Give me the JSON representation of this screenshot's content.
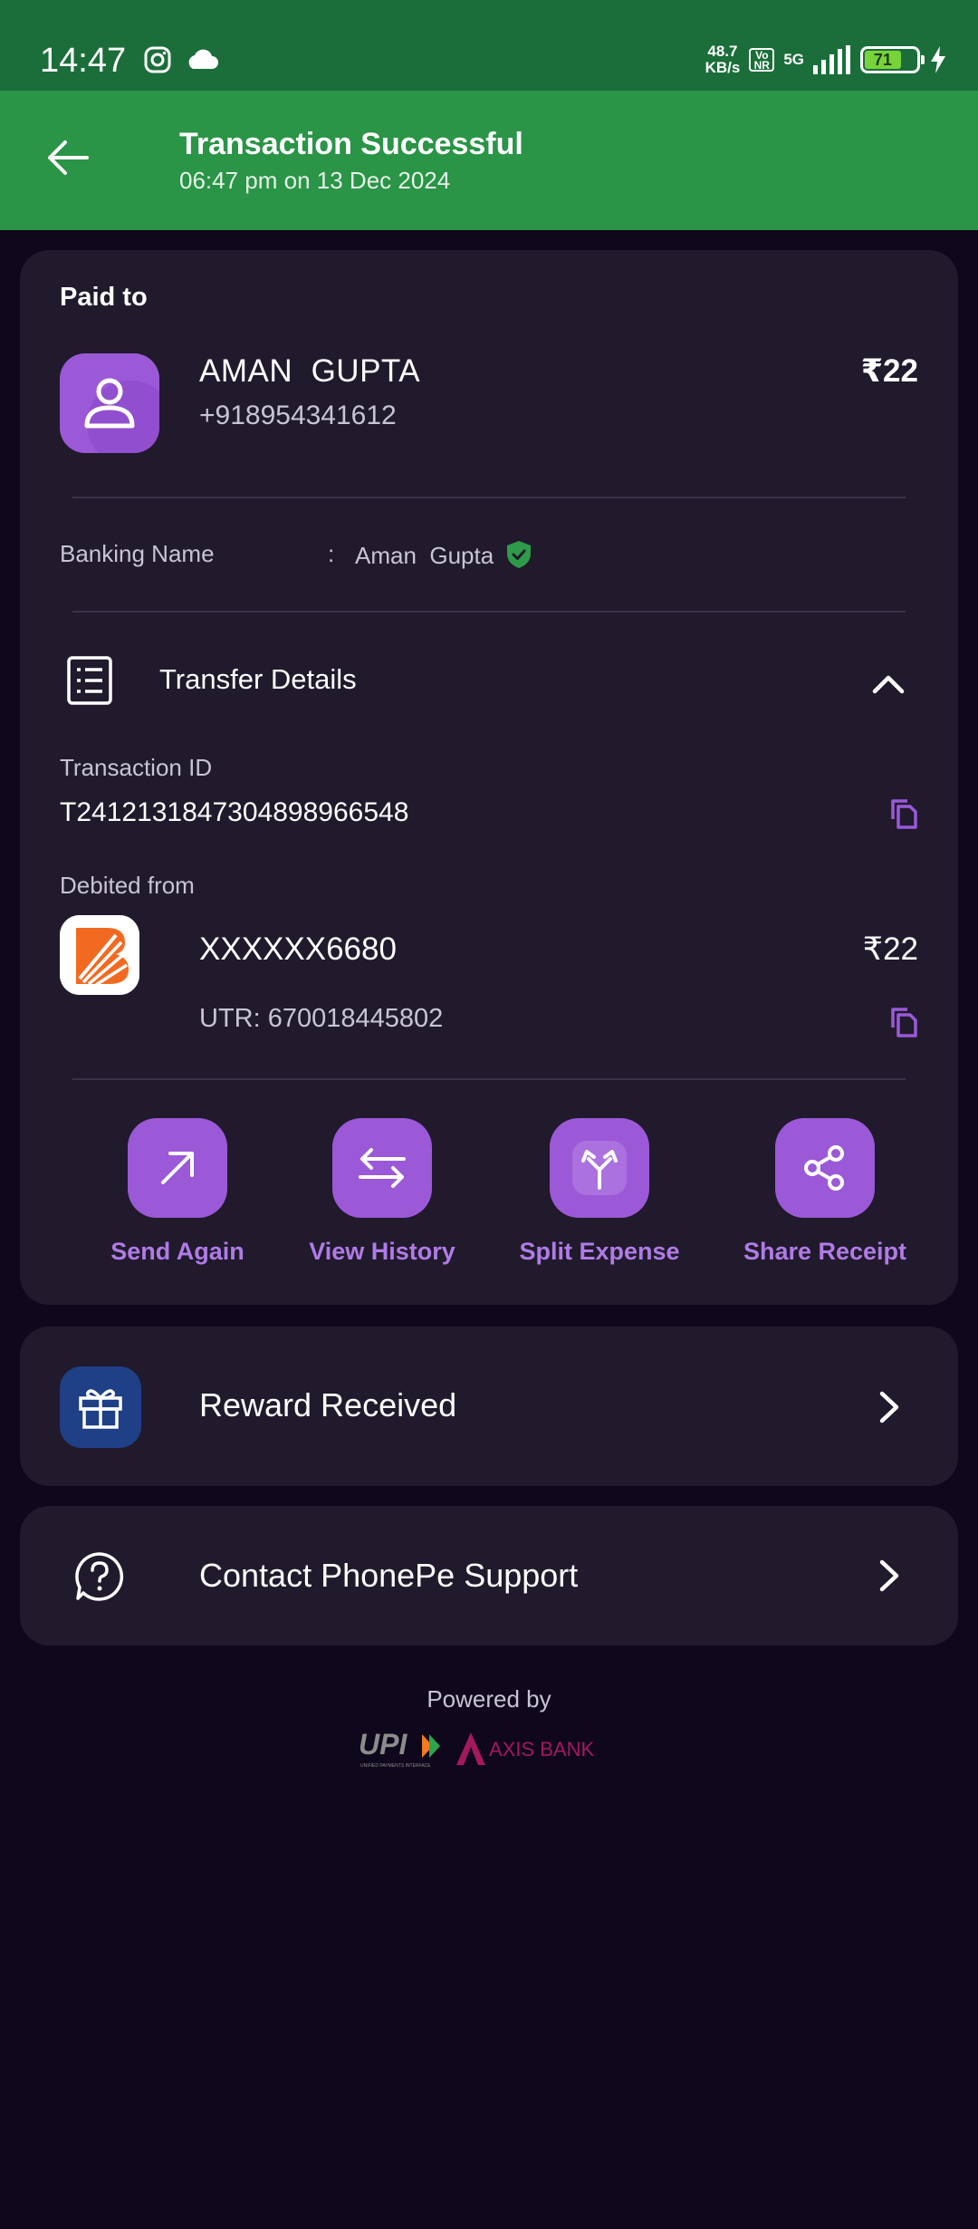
{
  "status_bar": {
    "time": "14:47",
    "net_speed_value": "48.7",
    "net_speed_unit": "KB/s",
    "volte_top": "Vo",
    "volte_bottom": "NR",
    "network": "5G",
    "battery": "71"
  },
  "header": {
    "title": "Transaction Successful",
    "subtitle": "06:47 pm on 13 Dec 2024"
  },
  "payment": {
    "paid_to_label": "Paid to",
    "name": "AMAN  GUPTA",
    "phone": "+918954341612",
    "amount": "₹22",
    "banking_name_label": "Banking Name",
    "banking_name_sep": ":",
    "banking_name_value": "Aman  Gupta"
  },
  "transfer": {
    "section_title": "Transfer Details",
    "txn_id_label": "Transaction ID",
    "txn_id": "T2412131847304898966548",
    "debited_label": "Debited from",
    "account": "XXXXXX6680",
    "amount": "₹22",
    "utr": "UTR: 670018445802"
  },
  "actions": [
    {
      "label": "Send Again",
      "icon": "arrow-up-right-icon"
    },
    {
      "label": "View History",
      "icon": "swap-arrows-icon"
    },
    {
      "label": "Split Expense",
      "icon": "split-icon"
    },
    {
      "label": "Share Receipt",
      "icon": "share-icon"
    }
  ],
  "reward": {
    "label": "Reward Received"
  },
  "support": {
    "label": "Contact PhonePe Support"
  },
  "footer": {
    "powered_by": "Powered by",
    "upi_logo_text": "UPI",
    "upi_logo_subtext": "UNIFIED PAYMENTS INTERFACE",
    "bank_logo_text": "AXIS BANK"
  },
  "colors": {
    "status_bar_bg": "#1b6e3a",
    "header_bg": "#2a9447",
    "page_bg": "#0f071b",
    "card_bg": "#201a2c",
    "accent": "#9b59d8",
    "accent_text": "#b07be6",
    "verified_green": "#2e9b4a",
    "axis_brand": "#a4195e"
  }
}
